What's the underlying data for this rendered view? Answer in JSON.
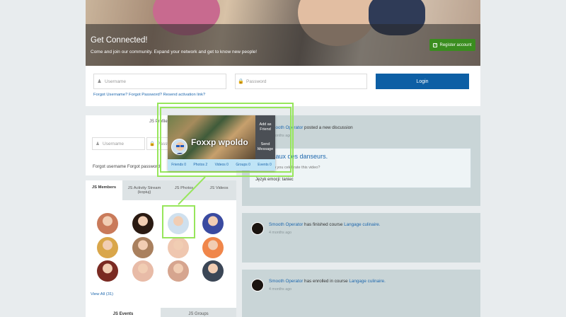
{
  "hero": {
    "title": "Get Connected!",
    "subtitle": "Come and join our community. Expand your network and get to know new people!",
    "register_label": "Register account"
  },
  "login": {
    "username_placeholder": "Username",
    "password_placeholder": "Password",
    "login_label": "Login",
    "forgot_text": "Forgot Username? Forgot Password? Resend activation link?"
  },
  "sidebar_login": {
    "tab_label": "JS Profile",
    "username_placeholder": "Username",
    "password_placeholder": "Password",
    "forgot_text": "Forgot username Forgot password"
  },
  "members_module": {
    "tabs": [
      "JS Members",
      "JS Activity Stream (kopiuj)",
      "JS Photos",
      "JS Videos"
    ],
    "view_all": "View All (31)",
    "member_colors": [
      "#c97a5a",
      "#2a1a12",
      "#cfe0ee",
      "#3a4aa0",
      "#d9a64a",
      "#a9805e",
      "#efc7b0",
      "#f0864a",
      "#7a2a22",
      "#e8bba7",
      "#d6a58f",
      "#3b4656"
    ]
  },
  "bottom_tabs": [
    "JS Events",
    "JS Groups"
  ],
  "profile_card": {
    "name": "Foxxp wpoldo",
    "add_friend": "Add as Friend",
    "send_message": "Send Message",
    "stats": [
      "Friends 0",
      "Photos 2",
      "Videos 0",
      "Groups 0",
      "Events 0"
    ]
  },
  "activity": {
    "items": [
      {
        "actor": "Smooth Operator",
        "action": " posted a new discussion",
        "time": "4 months ago",
        "title": "Les locaux des danseurs.",
        "question": "Do you celebrate this video?",
        "language": "Język emocji: taniec"
      },
      {
        "actor": "Smooth Operator",
        "action": " has finished course ",
        "course": "Langage culinaire.",
        "time": "4 months ago"
      },
      {
        "actor": "Smooth Operator",
        "action": " has enrolled in course ",
        "course": "Langage culinaire.",
        "time": "4 months ago"
      }
    ]
  },
  "colors": {
    "brand_blue": "#0d5fa5",
    "register_green": "#3a8d1f",
    "highlight_green": "#97e65b",
    "panel_bg": "#c9d5d7"
  }
}
